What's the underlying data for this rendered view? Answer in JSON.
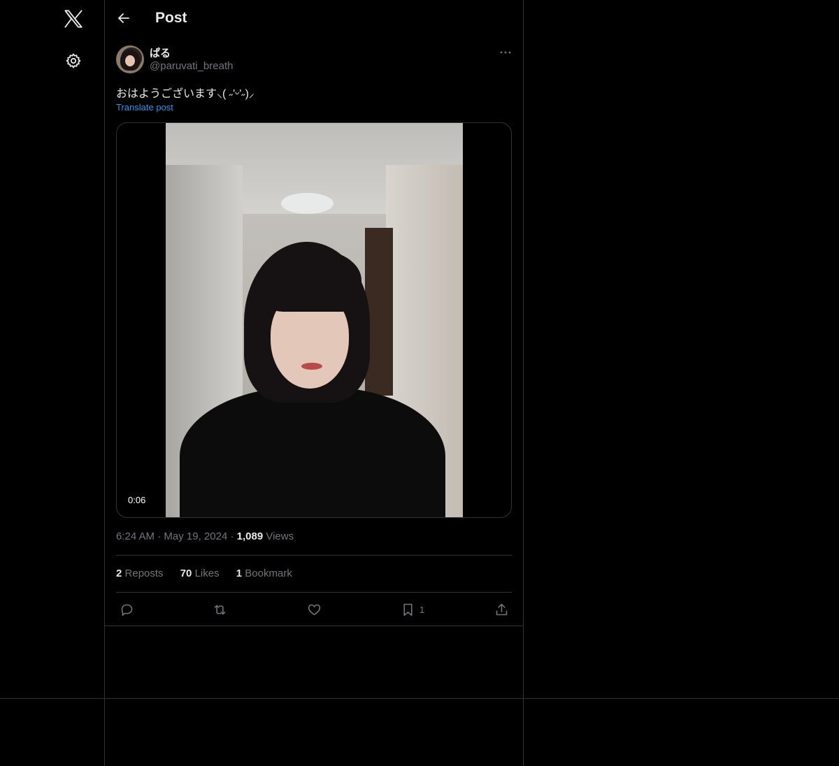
{
  "nav": {
    "logo_icon": "x-logo-icon",
    "settings_icon": "gear-icon"
  },
  "header": {
    "title": "Post"
  },
  "post": {
    "display_name": "ぱる",
    "handle": "@paruvati_breath",
    "text": "おはようございます⸜( ˶'ᵕ'˶)⸝",
    "translate_label": "Translate post",
    "video_duration": "0:06",
    "time": "6:24 AM",
    "date": "May 19, 2024",
    "views_count": "1,089",
    "views_label": "Views",
    "reposts_count": "2",
    "reposts_label": "Reposts",
    "likes_count": "70",
    "likes_label": "Likes",
    "bookmarks_count": "1",
    "bookmarks_label": "Bookmark",
    "bookmark_action_count": "1"
  },
  "colors": {
    "background": "#000000",
    "border": "#2f3336",
    "accent": "#1d9bf0",
    "muted": "#71767b",
    "text": "#e7e9ea"
  }
}
